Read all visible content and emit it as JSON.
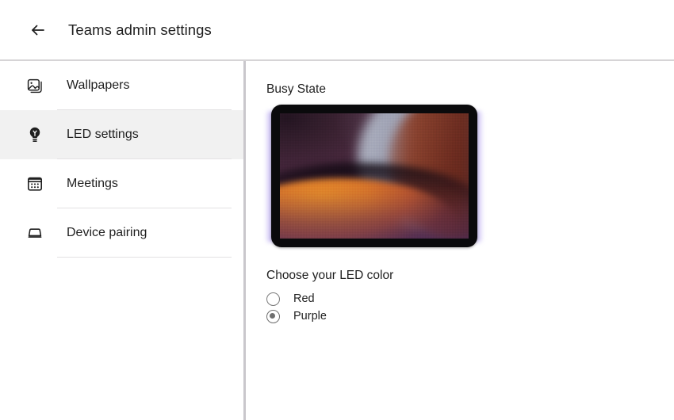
{
  "header": {
    "back_icon": "arrow-left-icon",
    "title": "Teams admin settings"
  },
  "sidebar": {
    "items": [
      {
        "label": "Wallpapers",
        "icon": "image-icon",
        "selected": false
      },
      {
        "label": "LED settings",
        "icon": "lightbulb-icon",
        "selected": true
      },
      {
        "label": "Meetings",
        "icon": "calendar-icon",
        "selected": false
      },
      {
        "label": "Device pairing",
        "icon": "device-icon",
        "selected": false
      }
    ]
  },
  "main": {
    "section_title": "Busy State",
    "preview": {
      "device": "tablet",
      "led_glow_color": "#b6a6f0",
      "wallpaper_colors": [
        "#43253a",
        "#c4cdda",
        "#88341a",
        "#d8762b",
        "#56326 2"
      ]
    },
    "led_color": {
      "title": "Choose your LED color",
      "options": [
        {
          "label": "Red",
          "selected": false
        },
        {
          "label": "Purple",
          "selected": true
        }
      ]
    }
  }
}
